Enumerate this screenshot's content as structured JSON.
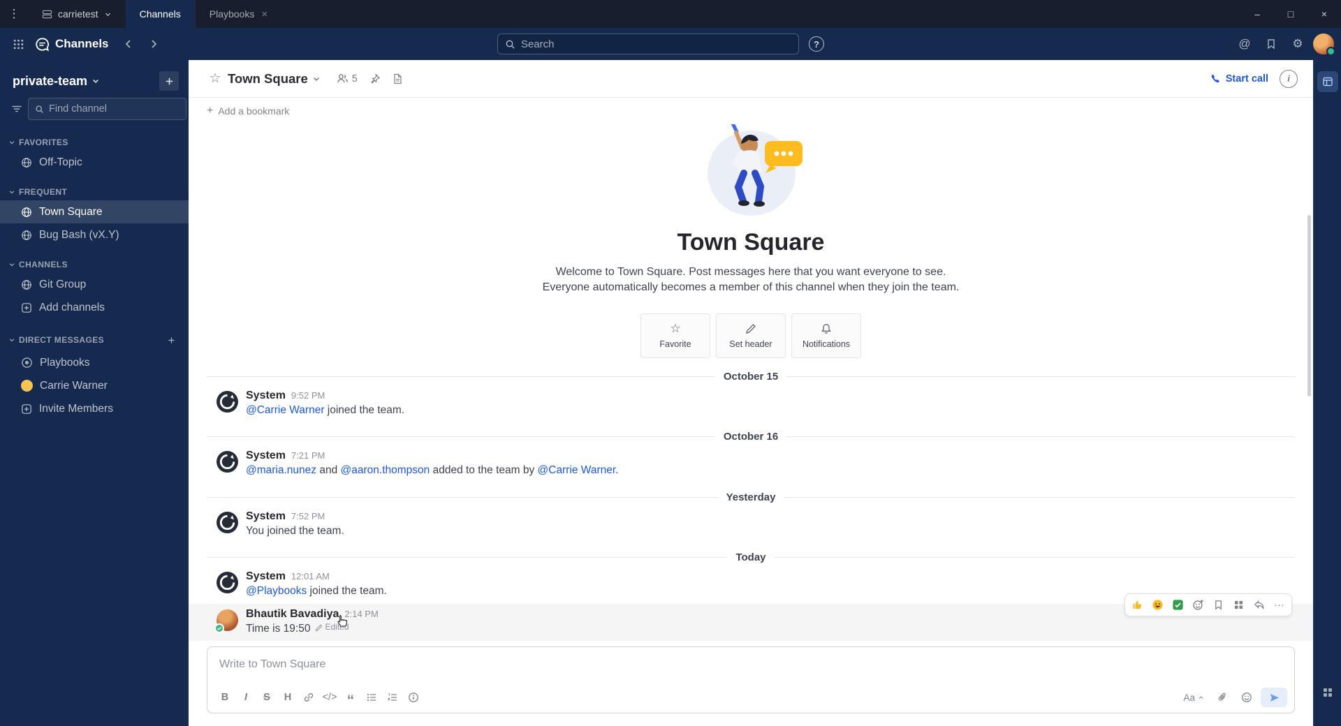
{
  "window": {
    "workspace": "carrietest",
    "tab_channels": "Channels",
    "tab_playbooks": "Playbooks"
  },
  "header": {
    "product": "Channels",
    "search_placeholder": "Search"
  },
  "glyphs": {
    "menu": "⋮",
    "minimize": "–",
    "maximize": "□",
    "close": "×",
    "tab_close": "×",
    "help": "?",
    "at": "@",
    "gear": "⚙",
    "star": "☆",
    "info": "i",
    "bold": "B",
    "italic": "I",
    "strike": "S",
    "heading": "H",
    "code": "</>",
    "quote": "“",
    "dots": "···",
    "plus": "+",
    "aa": "Aa"
  },
  "sidebar": {
    "team": "private-team",
    "find_placeholder": "Find channel",
    "sections": {
      "favorites": "FAVORITES",
      "frequent": "FREQUENT",
      "channels": "CHANNELS",
      "dms": "DIRECT MESSAGES"
    },
    "items": {
      "offtopic": "Off-Topic",
      "townsquare": "Town Square",
      "bugbash": "Bug Bash (vX.Y)",
      "gitgroup": "Git Group",
      "addchannels": "Add channels",
      "playbooks": "Playbooks",
      "carrie": "Carrie Warner",
      "invite": "Invite Members"
    }
  },
  "channel": {
    "name": "Town Square",
    "member_count": "5",
    "start_call": "Start call",
    "add_bookmark": "Add a bookmark"
  },
  "intro": {
    "title": "Town Square",
    "description": "Welcome to Town Square. Post messages here that you want everyone to see. Everyone automatically becomes a member of this channel when they join the team.",
    "favorite": "Favorite",
    "set_header": "Set header",
    "notifications": "Notifications"
  },
  "dividers": {
    "d1": "October 15",
    "d2": "October 16",
    "d3": "Yesterday",
    "d4": "Today"
  },
  "messages": {
    "m1": {
      "sender": "System",
      "time": "9:52 PM",
      "link1": "@Carrie Warner",
      "text1": " joined the team."
    },
    "m2": {
      "sender": "System",
      "time": "7:21 PM",
      "link1": "@maria.nunez",
      "text1": " and ",
      "link2": "@aaron.thompson",
      "text2": " added to the team by ",
      "link3": "@Carrie Warner",
      "text3": "."
    },
    "m3": {
      "sender": "System",
      "time": "7:52 PM",
      "text1": "You joined the team."
    },
    "m4": {
      "sender": "System",
      "time": "12:01 AM",
      "link1": "@Playbooks",
      "text1": " joined the team."
    },
    "m5": {
      "sender": "Bhautik Bavadiya",
      "time": "2:14 PM",
      "text1": "Time is 19:50",
      "edited": "Edited"
    }
  },
  "composer": {
    "placeholder": "Write to Town Square"
  },
  "colors": {
    "accent": "#1c58d9",
    "link": "#1c58d9",
    "online": "#3db887",
    "sidebar_bg": "#152a4e",
    "titlebar_bg": "#191e2e"
  }
}
